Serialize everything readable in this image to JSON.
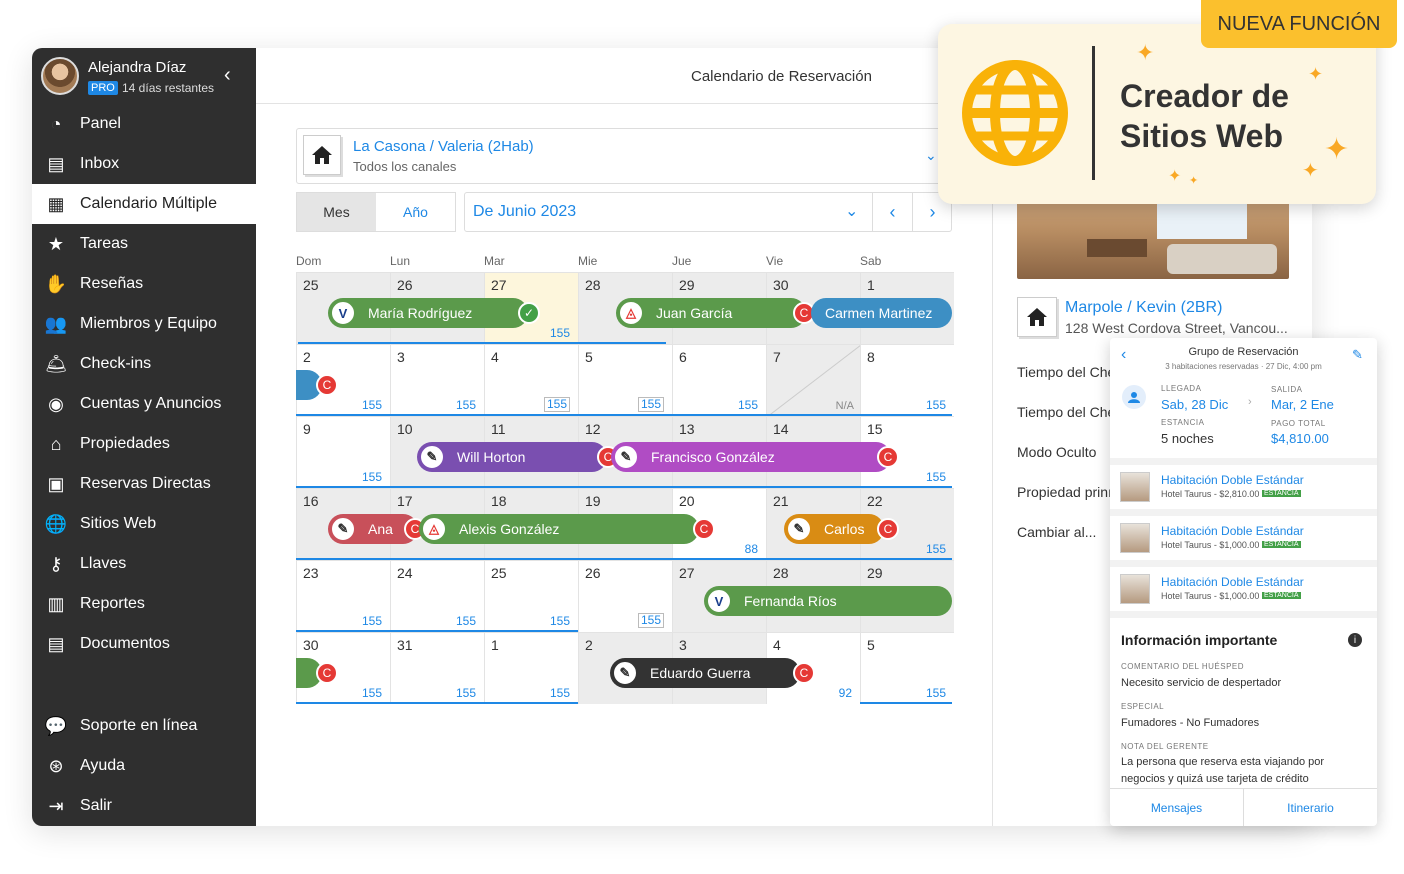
{
  "sidebar": {
    "user_name": "Alejandra Díaz",
    "plan_badge": "PRO",
    "days_left": "14 días restantes",
    "items": [
      {
        "label": "Panel",
        "icon": "dashboard-icon"
      },
      {
        "label": "Inbox",
        "icon": "inbox-icon"
      },
      {
        "label": "Calendario Múltiple",
        "icon": "calendar-icon",
        "active": true
      },
      {
        "label": "Tareas",
        "icon": "star-icon"
      },
      {
        "label": "Reseñas",
        "icon": "review-icon"
      },
      {
        "label": "Miembros y Equipo",
        "icon": "team-icon"
      },
      {
        "label": "Check-ins",
        "icon": "bell-icon"
      },
      {
        "label": "Cuentas y Anuncios",
        "icon": "account-icon"
      },
      {
        "label": "Propiedades",
        "icon": "home-icon"
      },
      {
        "label": "Reservas Directas",
        "icon": "direct-booking-icon"
      },
      {
        "label": "Sitios Web",
        "icon": "globe-icon"
      },
      {
        "label": "Llaves",
        "icon": "key-icon"
      },
      {
        "label": "Reportes",
        "icon": "chart-icon"
      },
      {
        "label": "Documentos",
        "icon": "document-icon"
      }
    ],
    "bottom_items": [
      {
        "label": "Soporte en línea",
        "icon": "chat-icon"
      },
      {
        "label": "Ayuda",
        "icon": "help-icon"
      },
      {
        "label": "Salir",
        "icon": "logout-icon"
      }
    ]
  },
  "header": {
    "title": "Calendario de Reservación"
  },
  "property_select": {
    "name": "La Casona / Valeria (2Hab)",
    "sub": "Todos los canales"
  },
  "view_toggle": {
    "month": "Mes",
    "year": "Año"
  },
  "month_select": {
    "label": "De Junio 2023"
  },
  "calendar": {
    "weekdays": [
      "Dom",
      "Lun",
      "Mar",
      "Mie",
      "Jue",
      "Vie",
      "Sab"
    ],
    "weeks": [
      [
        {
          "d": "25",
          "p": ""
        },
        {
          "d": "26",
          "p": ""
        },
        {
          "d": "27",
          "p": "155",
          "today": true
        },
        {
          "d": "28",
          "p": ""
        },
        {
          "d": "29",
          "p": ""
        },
        {
          "d": "30",
          "p": ""
        },
        {
          "d": "1",
          "p": ""
        }
      ],
      [
        {
          "d": "2",
          "p": "155"
        },
        {
          "d": "3",
          "p": "155"
        },
        {
          "d": "4",
          "p": "155",
          "box": true
        },
        {
          "d": "5",
          "p": "155",
          "box": true
        },
        {
          "d": "6",
          "p": "155"
        },
        {
          "d": "7",
          "p": "N/A",
          "na": true
        },
        {
          "d": "8",
          "p": "155"
        }
      ],
      [
        {
          "d": "9",
          "p": "155"
        },
        {
          "d": "10",
          "p": ""
        },
        {
          "d": "11",
          "p": ""
        },
        {
          "d": "12",
          "p": ""
        },
        {
          "d": "13",
          "p": ""
        },
        {
          "d": "14",
          "p": ""
        },
        {
          "d": "15",
          "p": "155"
        }
      ],
      [
        {
          "d": "16",
          "p": ""
        },
        {
          "d": "17",
          "p": ""
        },
        {
          "d": "18",
          "p": ""
        },
        {
          "d": "19",
          "p": ""
        },
        {
          "d": "20",
          "p": "88"
        },
        {
          "d": "21",
          "p": ""
        },
        {
          "d": "22",
          "p": "155"
        }
      ],
      [
        {
          "d": "23",
          "p": "155"
        },
        {
          "d": "24",
          "p": "155"
        },
        {
          "d": "25",
          "p": "155"
        },
        {
          "d": "26",
          "p": "155",
          "box": true
        },
        {
          "d": "27",
          "p": ""
        },
        {
          "d": "28",
          "p": ""
        },
        {
          "d": "29",
          "p": ""
        }
      ],
      [
        {
          "d": "30",
          "p": "155"
        },
        {
          "d": "31",
          "p": "155"
        },
        {
          "d": "1",
          "p": "155"
        },
        {
          "d": "2",
          "p": ""
        },
        {
          "d": "3",
          "p": ""
        },
        {
          "d": "4",
          "p": "92"
        },
        {
          "d": "5",
          "p": "155"
        }
      ]
    ],
    "bookings": [
      {
        "name": "María Rodríguez",
        "color": "#5b9a4b",
        "source": "V",
        "status": "check"
      },
      {
        "name": "Juan García",
        "color": "#5b9a4b",
        "source": "airbnb",
        "status": "C"
      },
      {
        "name": "Carmen Martinez",
        "color": "#3d8fc4",
        "source": "",
        "status": ""
      },
      {
        "name": "Will Horton",
        "color": "#7a4fb0",
        "source": "edit",
        "status": "C"
      },
      {
        "name": "Francisco González",
        "color": "#b04cc4",
        "source": "edit",
        "status": "C"
      },
      {
        "name": "Ana",
        "color": "#c8505a",
        "source": "edit",
        "status": "C"
      },
      {
        "name": "Alexis González",
        "color": "#5b9a4b",
        "source": "airbnb",
        "status": "C"
      },
      {
        "name": "Carlos",
        "color": "#d98c14",
        "source": "edit",
        "status": "C"
      },
      {
        "name": "Fernanda Ríos",
        "color": "#5b9a4b",
        "source": "V",
        "status": ""
      },
      {
        "name": "Eduardo Guerra",
        "color": "#333333",
        "source": "edit",
        "status": "C"
      }
    ]
  },
  "right_panel": {
    "prop_name": "Marpole / Kevin (2BR)",
    "prop_addr": "128 West Cordova Street, Vancou...",
    "rows": [
      "Tiempo del Che",
      "Tiempo del Che",
      "Modo Oculto",
      "Propiedad prinı",
      "Cambiar al..."
    ]
  },
  "promo": {
    "tag": "NUEVA FUNCIÓN",
    "title_line1": "Creador de",
    "title_line2": "Sitios Web"
  },
  "reservation": {
    "title": "Grupo de Reservación",
    "sub": "3 habitaciones reservadas · 27 Dic, 4:00 pm",
    "arrival_label": "LLEGADA",
    "arrival": "Sab, 28 Dic",
    "departure_label": "SALIDA",
    "departure": "Mar, 2 Ene",
    "stay_label": "ESTANCIA",
    "stay": "5 noches",
    "total_label": "PAGO TOTAL",
    "total": "$4,810.00",
    "rooms": [
      {
        "name": "Habitación Doble Estándar",
        "sub": "Hotel Taurus - $2,810.00",
        "tag": "ESTANCIA"
      },
      {
        "name": "Habitación Doble Estándar",
        "sub": "Hotel Taurus - $1,000.00",
        "tag": "ESTANCIA"
      },
      {
        "name": "Habitación Doble Estándar",
        "sub": "Hotel Taurus - $1,000.00",
        "tag": "ESTANCIA"
      }
    ],
    "info_title": "Información importante",
    "guest_comment_label": "COMENTARIO DEL HUÉSPED",
    "guest_comment": "Necesito servicio de despertador",
    "special_label": "ESPECIAL",
    "special": "Fumadores - No Fumadores",
    "manager_label": "NOTA DEL GERENTE",
    "manager_note": "La persona que reserva esta viajando por negocios y quizá use tarjeta de crédito",
    "tab_messages": "Mensajes",
    "tab_itinerary": "Itinerario"
  },
  "colors": {
    "accent": "#1e88e5",
    "sidebar_bg": "#2f2f2f",
    "promo_yellow": "#fbc02d",
    "cancel_red": "#e53935"
  }
}
